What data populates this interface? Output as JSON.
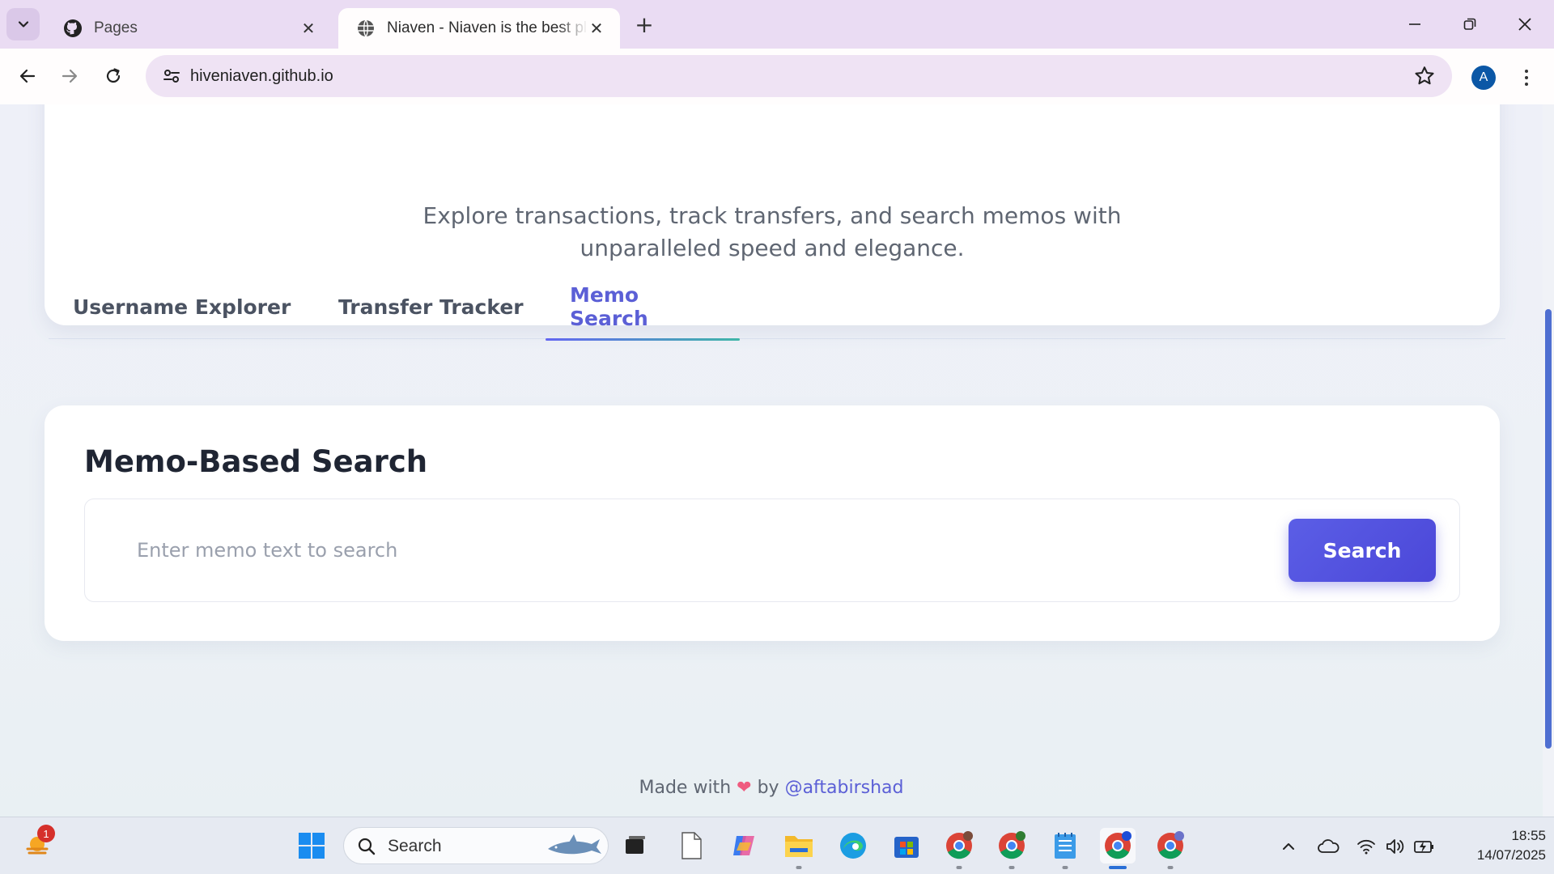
{
  "browser": {
    "tabs": [
      {
        "title": "Pages",
        "favicon": "github-icon",
        "active": false
      },
      {
        "title": "Niaven - Niaven is the best platform",
        "favicon": "globe-icon",
        "active": true
      }
    ],
    "url": "hiveniaven.github.io",
    "profile_initial": "A"
  },
  "page": {
    "hero_subtitle_line1": "Explore transactions, track transfers, and search memos with",
    "hero_subtitle_line2": "unparalleled speed and elegance.",
    "tabs": [
      {
        "label": "Username Explorer",
        "active": false
      },
      {
        "label": "Transfer Tracker",
        "active": false
      },
      {
        "label": "Memo Search",
        "active": true
      }
    ],
    "memo_search": {
      "title": "Memo-Based Search",
      "placeholder": "Enter memo text to search",
      "button_label": "Search"
    },
    "footer": {
      "prefix": "Made with",
      "heart": "❤",
      "by": "by",
      "handle": "@aftabirshad"
    }
  },
  "taskbar": {
    "search_label": "Search",
    "notification_count": "1",
    "time": "18:55",
    "date": "14/07/2025",
    "accent_color": "#2a6fd6"
  },
  "colors": {
    "accent": "#5b5fd6",
    "button": "#4b47d8",
    "tabstrip": "#eadcf3"
  }
}
